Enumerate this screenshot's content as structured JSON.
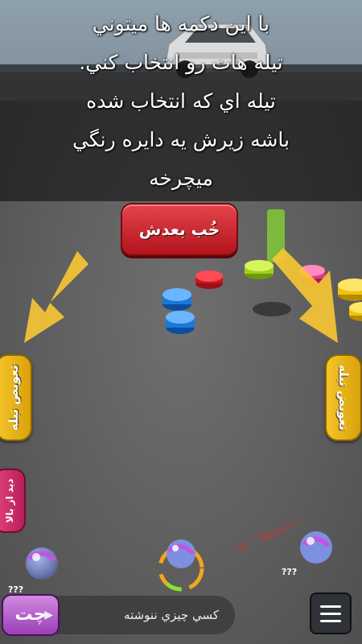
{
  "tutorial": {
    "lines": [
      "با اين دکمه ها ميتوني",
      "تيله هات رو انتخاب کني.",
      "تيله اي که انتخاب شده",
      "باشه زيرش يه دايره رنگي",
      "ميچرخه"
    ]
  },
  "next_button": {
    "label": "خُب بعدش"
  },
  "left_tab": {
    "label": "تعويض تيله"
  },
  "right_tab": {
    "label": "تعويض تيله"
  },
  "view_tab": {
    "label": "ديد از بالا"
  },
  "chat": {
    "button_label": "چت",
    "placeholder": "کسي چيزي ننوشته"
  },
  "marble_labels": [
    "???",
    "???"
  ],
  "colors": {
    "next_button": "#c9242c",
    "tab_yellow": "#f0b81a",
    "arrow_yellow": "#f6c535",
    "chat_purple": "#b560cf",
    "view_pink": "#d23068"
  },
  "icons": {
    "menu": "hamburger-icon",
    "chat_chevron": "chevron-right-icon",
    "tutorial_arrows": "arrow-down-icon"
  }
}
